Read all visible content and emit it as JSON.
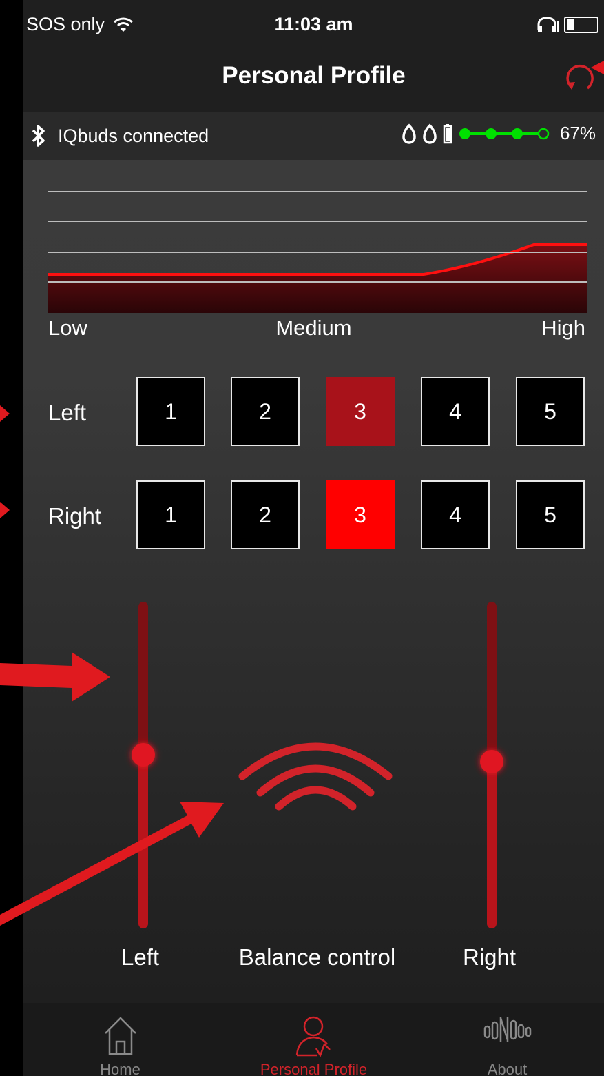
{
  "status_bar": {
    "carrier": "SOS only",
    "time": "11:03 am"
  },
  "nav": {
    "title": "Personal Profile"
  },
  "connection": {
    "label": "IQbuds connected",
    "battery_percent": "67%"
  },
  "eq_chart": {
    "low_label": "Low",
    "medium_label": "Medium",
    "high_label": "High"
  },
  "level_rows": [
    {
      "label": "Left",
      "options": [
        "1",
        "2",
        "3",
        "4",
        "5"
      ],
      "selected": 3
    },
    {
      "label": "Right",
      "options": [
        "1",
        "2",
        "3",
        "4",
        "5"
      ],
      "selected": 3
    }
  ],
  "balance": {
    "left_label": "Left",
    "center_label": "Balance control",
    "right_label": "Right",
    "left_level": 0.51,
    "right_level": 0.51
  },
  "tabs": [
    {
      "label": "Home",
      "icon": "home-icon",
      "active": false
    },
    {
      "label": "Personal Profile",
      "icon": "profile-icon",
      "active": true
    },
    {
      "label": "About",
      "icon": "about-icon",
      "active": false
    }
  ],
  "colors": {
    "accent": "#d2232a",
    "selected_left": "#a8121a",
    "selected_right": "#ff0000",
    "battery_green": "#00e000"
  }
}
